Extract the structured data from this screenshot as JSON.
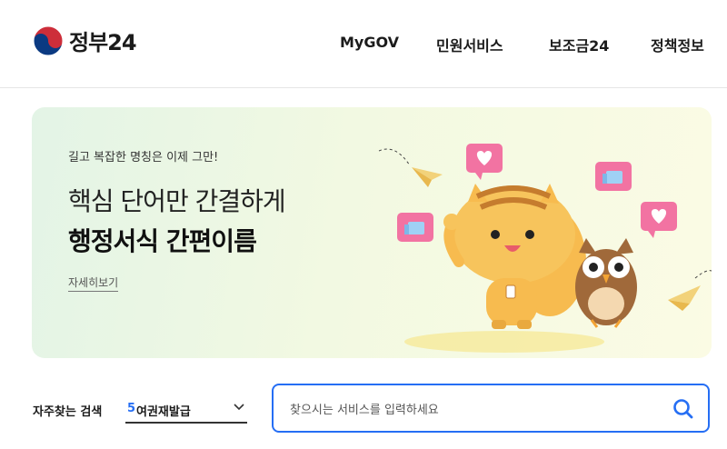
{
  "header": {
    "logo_text": "정부24",
    "nav": [
      {
        "label": "MyGOV"
      },
      {
        "label": "민원서비스"
      },
      {
        "label": "보조금24"
      },
      {
        "label": "정책정보"
      }
    ]
  },
  "banner": {
    "subtitle": "길고 복잡한 명칭은 이제 그만!",
    "headline_line1": "핵심 단어만 간결하게",
    "headline_line2": "행정서식 간편이름",
    "more_link": "자세히보기"
  },
  "search": {
    "favorites_label": "자주찾는 검색",
    "favorite_rank": "5",
    "favorite_value": "여권재발급",
    "placeholder": "찾으시는 서비스를 입력하세요"
  },
  "colors": {
    "accent": "#256ef4",
    "heart_pink": "#f273a2",
    "mascot_orange": "#f7bb4f"
  },
  "icons": [
    "taegeuk-logo-icon",
    "chevron-down-icon",
    "search-icon",
    "heart-icon",
    "thumbs-up-icon",
    "paper-plane-icon"
  ]
}
